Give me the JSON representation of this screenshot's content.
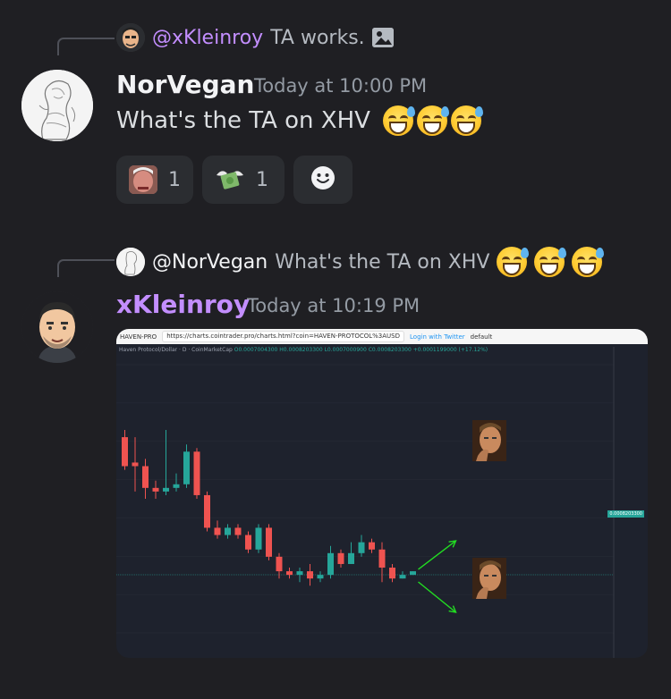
{
  "messages": [
    {
      "reply": {
        "user": "@xKleinroy",
        "text": "TA works.",
        "icon": "image-icon"
      },
      "author": "NorVegan",
      "author_color": "#f2f3f5",
      "timestamp": "Today at 10:00 PM",
      "text": "What's the TA on XHV",
      "emojis": [
        "sweat-smile",
        "sweat-smile",
        "sweat-smile"
      ],
      "reactions": [
        {
          "icon": "face-emoji",
          "count": "1"
        },
        {
          "icon": "money-with-wings-emoji",
          "count": "1"
        },
        {
          "icon": "add-reaction-icon",
          "count": ""
        }
      ]
    },
    {
      "reply": {
        "user": "@NorVegan",
        "text": "What's the TA on XHV",
        "emojis": [
          "sweat-smile",
          "sweat-smile",
          "sweat-smile"
        ]
      },
      "author": "xKleinroy",
      "author_color": "#c38eff",
      "timestamp": "Today at 10:19 PM",
      "attachment": {
        "browser_tab": "HAVEN-PRO",
        "url": "https://charts.cointrader.pro/charts.html?coin=HAVEN-PROTOCOL%3AUSD",
        "login_label": "Login with Twitter",
        "theme_label": "default",
        "legend_title": "Haven Protocol/Dollar · D · CoinMarketCap",
        "legend_values": "O0.0007004300 H0.0008203300 L0.0007000900 C0.0008203300 +0.0001199000 (+17.12%)",
        "price_tag": "0.0008203300"
      }
    }
  ],
  "chart_data": {
    "type": "candlestick",
    "title": "Haven Protocol/Dollar · D · CoinMarketCap",
    "candles": [
      {
        "o": 0.0012,
        "c": 0.00112,
        "h": 0.00122,
        "l": 0.00111
      },
      {
        "o": 0.00113,
        "c": 0.00112,
        "h": 0.0012,
        "l": 0.00105
      },
      {
        "o": 0.00112,
        "c": 0.00106,
        "h": 0.00114,
        "l": 0.00103
      },
      {
        "o": 0.00106,
        "c": 0.00105,
        "h": 0.00108,
        "l": 0.00103
      },
      {
        "o": 0.00105,
        "c": 0.00106,
        "h": 0.00122,
        "l": 0.00104
      },
      {
        "o": 0.00106,
        "c": 0.00107,
        "h": 0.0011,
        "l": 0.00105
      },
      {
        "o": 0.00107,
        "c": 0.00116,
        "h": 0.00118,
        "l": 0.00106
      },
      {
        "o": 0.00116,
        "c": 0.00104,
        "h": 0.00117,
        "l": 0.00103
      },
      {
        "o": 0.00104,
        "c": 0.00095,
        "h": 0.00105,
        "l": 0.00094
      },
      {
        "o": 0.00095,
        "c": 0.00093,
        "h": 0.00097,
        "l": 0.00092
      },
      {
        "o": 0.00093,
        "c": 0.00095,
        "h": 0.00096,
        "l": 0.00092
      },
      {
        "o": 0.00095,
        "c": 0.00093,
        "h": 0.00096,
        "l": 0.00092
      },
      {
        "o": 0.00093,
        "c": 0.00089,
        "h": 0.00094,
        "l": 0.00088
      },
      {
        "o": 0.00089,
        "c": 0.00095,
        "h": 0.00096,
        "l": 0.00088
      },
      {
        "o": 0.00095,
        "c": 0.00087,
        "h": 0.00096,
        "l": 0.00086
      },
      {
        "o": 0.00087,
        "c": 0.00083,
        "h": 0.00088,
        "l": 0.00081
      },
      {
        "o": 0.00083,
        "c": 0.00082,
        "h": 0.00084,
        "l": 0.00081
      },
      {
        "o": 0.00082,
        "c": 0.00083,
        "h": 0.00084,
        "l": 0.0008
      },
      {
        "o": 0.00083,
        "c": 0.00081,
        "h": 0.00085,
        "l": 0.00079
      },
      {
        "o": 0.00081,
        "c": 0.00082,
        "h": 0.00083,
        "l": 0.0008
      },
      {
        "o": 0.00082,
        "c": 0.00088,
        "h": 0.0009,
        "l": 0.00081
      },
      {
        "o": 0.00088,
        "c": 0.00085,
        "h": 0.00089,
        "l": 0.00084
      },
      {
        "o": 0.00085,
        "c": 0.00088,
        "h": 0.00091,
        "l": 0.00085
      },
      {
        "o": 0.00088,
        "c": 0.00091,
        "h": 0.00093,
        "l": 0.00087
      },
      {
        "o": 0.00091,
        "c": 0.00089,
        "h": 0.00092,
        "l": 0.00088
      },
      {
        "o": 0.00089,
        "c": 0.00084,
        "h": 0.00091,
        "l": 0.0008
      },
      {
        "o": 0.00084,
        "c": 0.00081,
        "h": 0.00085,
        "l": 0.0008
      },
      {
        "o": 0.00081,
        "c": 0.00082,
        "h": 0.00083,
        "l": 0.00081
      },
      {
        "o": 0.00082,
        "c": 0.00083,
        "h": 0.00083,
        "l": 0.00082
      }
    ],
    "ylim": [
      0.00066,
      0.0014
    ],
    "current_price": 0.00082033,
    "colors": {
      "up": "#26a69a",
      "down": "#ef5350",
      "arrow": "#22dd22",
      "grid": "#2a2e39"
    }
  }
}
